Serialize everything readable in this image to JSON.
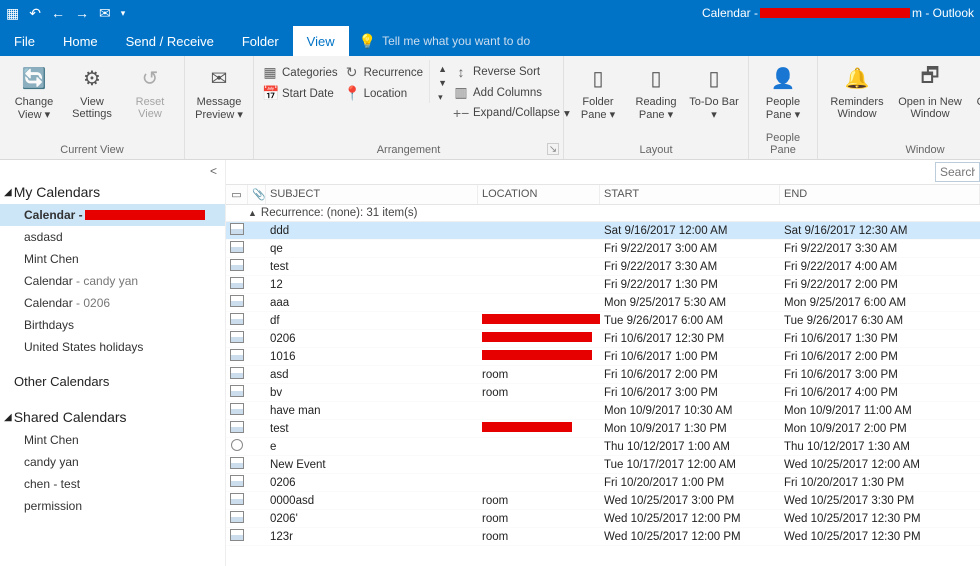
{
  "titlebar": {
    "app": "Outlook",
    "doc_prefix": "Calendar - ",
    "doc_suffix": "m  -  Outlook"
  },
  "tabs": {
    "file": "File",
    "home": "Home",
    "sendrecv": "Send / Receive",
    "folder": "Folder",
    "view": "View",
    "tellme": "Tell me what you want to do"
  },
  "ribbon": {
    "current_view": {
      "label": "Current View",
      "change_view": "Change View",
      "view_settings": "View Settings",
      "reset_view": "Reset View"
    },
    "msg_preview": "Message Preview",
    "arrangement": {
      "label": "Arrangement",
      "categories": "Categories",
      "start_date": "Start Date",
      "recurrence": "Recurrence",
      "location": "Location",
      "reverse_sort": "Reverse Sort",
      "add_columns": "Add Columns",
      "expand_collapse": "Expand/Collapse"
    },
    "layout": {
      "label": "Layout",
      "folder_pane": "Folder Pane",
      "reading_pane": "Reading Pane",
      "todo_bar": "To-Do Bar"
    },
    "people": {
      "label": "People Pane",
      "people_pane": "People Pane"
    },
    "window": {
      "label": "Window",
      "reminders": "Reminders Window",
      "new_window": "Open in New Window",
      "close_all": "Close All Items"
    }
  },
  "sidebar": {
    "my_calendars": "My Calendars",
    "other_calendars": "Other Calendars",
    "shared_calendars": "Shared Calendars",
    "items": [
      {
        "label": "Calendar - ",
        "selected": true,
        "red": true
      },
      {
        "label": "asdasd"
      },
      {
        "label": "Mint Chen"
      },
      {
        "label": "Calendar",
        "sub": " - candy yan"
      },
      {
        "label": "Calendar",
        "sub": " - 0206"
      },
      {
        "label": "Birthdays"
      },
      {
        "label": "United States holidays"
      }
    ],
    "shared_items": [
      {
        "label": "Mint Chen"
      },
      {
        "label": "candy yan"
      },
      {
        "label": "chen - test"
      },
      {
        "label": "permission"
      }
    ]
  },
  "search_placeholder": "Search C",
  "columns": {
    "subject": "SUBJECT",
    "location": "LOCATION",
    "start": "START",
    "end": "END"
  },
  "group_label": "Recurrence: (none): 31 item(s)",
  "rows": [
    {
      "subject": "ddd",
      "location": "",
      "start": "Sat 9/16/2017 12:00 AM",
      "end": "Sat 9/16/2017 12:30 AM",
      "sel": true
    },
    {
      "subject": "qe",
      "location": "",
      "start": "Fri 9/22/2017 3:00 AM",
      "end": "Fri 9/22/2017 3:30 AM"
    },
    {
      "subject": "test",
      "location": "",
      "start": "Fri 9/22/2017 3:30 AM",
      "end": "Fri 9/22/2017 4:00 AM"
    },
    {
      "subject": "12",
      "location": "",
      "start": "Fri 9/22/2017 1:30 PM",
      "end": "Fri 9/22/2017 2:00 PM"
    },
    {
      "subject": "aaa",
      "location": "",
      "start": "Mon 9/25/2017 5:30 AM",
      "end": "Mon 9/25/2017 6:00 AM"
    },
    {
      "subject": "df",
      "location": "",
      "redloc": 130,
      "start": "Tue 9/26/2017 6:00 AM",
      "end": "Tue 9/26/2017 6:30 AM"
    },
    {
      "subject": "0206",
      "location": "",
      "redloc": 110,
      "start": "Fri 10/6/2017 12:30 PM",
      "end": "Fri 10/6/2017 1:30 PM"
    },
    {
      "subject": "1016",
      "location": "",
      "redloc": 110,
      "start": "Fri 10/6/2017 1:00 PM",
      "end": "Fri 10/6/2017 2:00 PM"
    },
    {
      "subject": "asd",
      "location": "room",
      "start": "Fri 10/6/2017 2:00 PM",
      "end": "Fri 10/6/2017 3:00 PM"
    },
    {
      "subject": "bv",
      "location": "room",
      "start": "Fri 10/6/2017 3:00 PM",
      "end": "Fri 10/6/2017 4:00 PM"
    },
    {
      "subject": "have man",
      "location": "",
      "start": "Mon 10/9/2017 10:30 AM",
      "end": "Mon 10/9/2017 11:00 AM"
    },
    {
      "subject": "test",
      "location": "",
      "redloc": 90,
      "start": "Mon 10/9/2017 1:30 PM",
      "end": "Mon 10/9/2017 2:00 PM"
    },
    {
      "subject": "e",
      "location": "",
      "start": "Thu 10/12/2017 1:00 AM",
      "end": "Thu 10/12/2017 1:30 AM",
      "ring": true
    },
    {
      "subject": "New Event",
      "location": "",
      "start": "Tue 10/17/2017 12:00 AM",
      "end": "Wed 10/25/2017 12:00 AM"
    },
    {
      "subject": "0206",
      "location": "",
      "start": "Fri 10/20/2017 1:00 PM",
      "end": "Fri 10/20/2017 1:30 PM"
    },
    {
      "subject": "0000asd",
      "location": "room",
      "start": "Wed 10/25/2017 3:00 PM",
      "end": "Wed 10/25/2017 3:30 PM"
    },
    {
      "subject": "0206'",
      "location": "room",
      "start": "Wed 10/25/2017 12:00 PM",
      "end": "Wed 10/25/2017 12:30 PM"
    },
    {
      "subject": "123r",
      "location": "room",
      "start": "Wed 10/25/2017 12:00 PM",
      "end": "Wed 10/25/2017 12:30 PM"
    }
  ]
}
